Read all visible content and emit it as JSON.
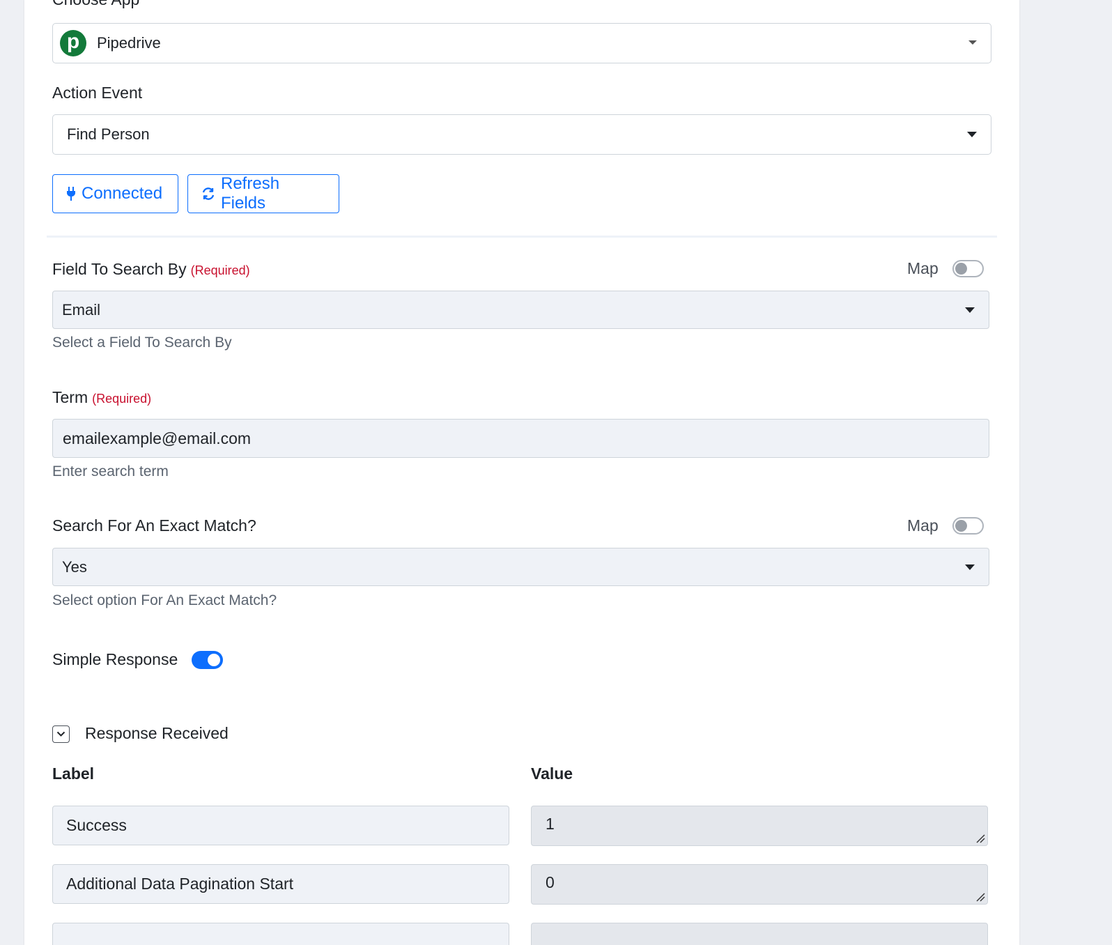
{
  "choose_app": {
    "label": "Choose App",
    "selected": "Pipedrive",
    "logo_letter": "p",
    "logo_color": "#137a3a"
  },
  "action_event": {
    "label": "Action Event",
    "selected": "Find Person"
  },
  "buttons": {
    "connected": "Connected",
    "refresh": "Refresh Fields"
  },
  "field_to_search": {
    "label": "Field To Search By",
    "required": "(Required)",
    "map_label": "Map",
    "map_on": false,
    "selected": "Email",
    "help": "Select a Field To Search By"
  },
  "term": {
    "label": "Term",
    "required": "(Required)",
    "value": "emailexample@email.com",
    "help": "Enter search term"
  },
  "exact_match": {
    "label": "Search For An Exact Match?",
    "map_label": "Map",
    "map_on": false,
    "selected": "Yes",
    "help": "Select option For An Exact Match?"
  },
  "simple_response": {
    "label": "Simple Response",
    "on": true
  },
  "response": {
    "title": "Response Received",
    "label_header": "Label",
    "value_header": "Value",
    "rows": [
      {
        "label": "Success",
        "value": "1"
      },
      {
        "label": "Additional Data Pagination Start",
        "value": "0"
      }
    ]
  },
  "colors": {
    "accent": "#0d6efd",
    "required": "#c8102e"
  }
}
